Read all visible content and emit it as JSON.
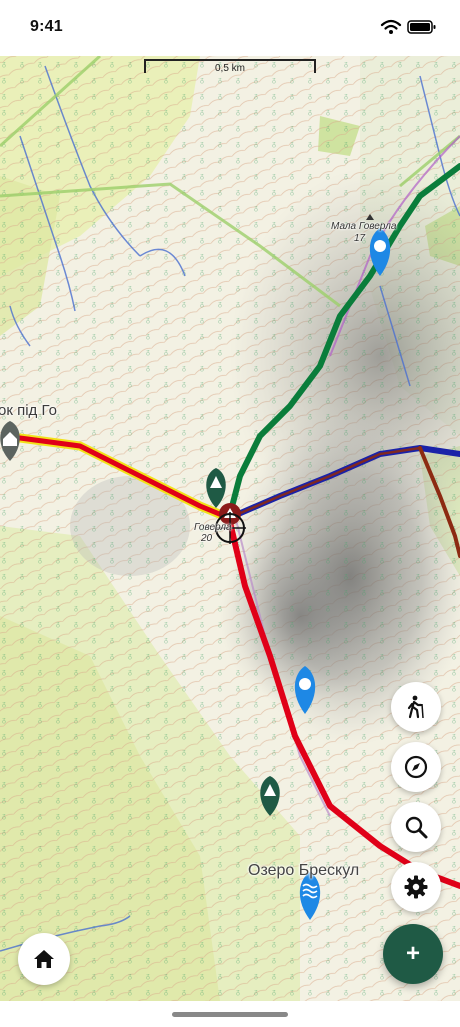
{
  "status_bar": {
    "time": "9:41"
  },
  "map": {
    "scale_label": "0,5 km",
    "labels": {
      "peak_name": "Мала Говерла",
      "peak_altitude": "17",
      "shelter": "ок під Го",
      "goverla_name": "Говерла",
      "goverla_altitude": "20",
      "lake": "Озеро Бреcкул"
    },
    "route_colors": {
      "red": "#e00018",
      "blue": "#1a22a8",
      "green": "#0a7d3b",
      "yellow": "#f2e21a",
      "brown": "#8c2a12"
    },
    "markers": {
      "water": "water-drop-marker",
      "forest": "tree-marker",
      "shelter": "house-marker",
      "lake": "waves-marker",
      "summit": "summit-marker",
      "location": "crosshair-marker"
    }
  },
  "controls": {
    "hike_icon": "hiking-person-icon",
    "compass_icon": "compass-icon",
    "search_icon": "search-icon",
    "settings_icon": "gear-icon",
    "home_icon": "home-icon",
    "add_label": "+"
  }
}
